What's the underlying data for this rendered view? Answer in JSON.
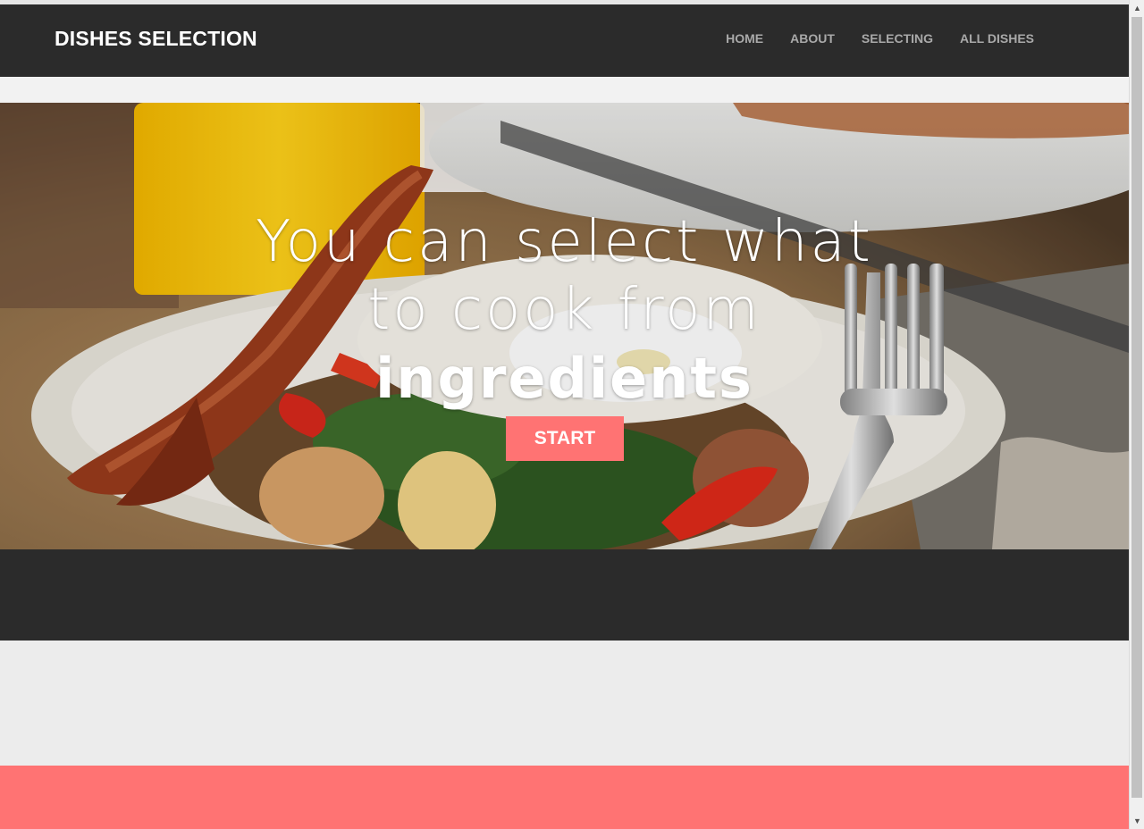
{
  "navbar": {
    "brand": "DISHES SELECTION",
    "links": [
      "HOME",
      "ABOUT",
      "SELECTING",
      "ALL DISHES"
    ]
  },
  "hero": {
    "line1": "You can select what",
    "line2": "to cook from",
    "emphasis": "ingredients",
    "start_label": "START"
  },
  "scrollbar": {
    "up_icon": "▲",
    "down_icon": "▼"
  },
  "colors": {
    "nav_bg": "#2b2b2b",
    "accent": "#ff7373",
    "page_bg": "#ececec"
  }
}
